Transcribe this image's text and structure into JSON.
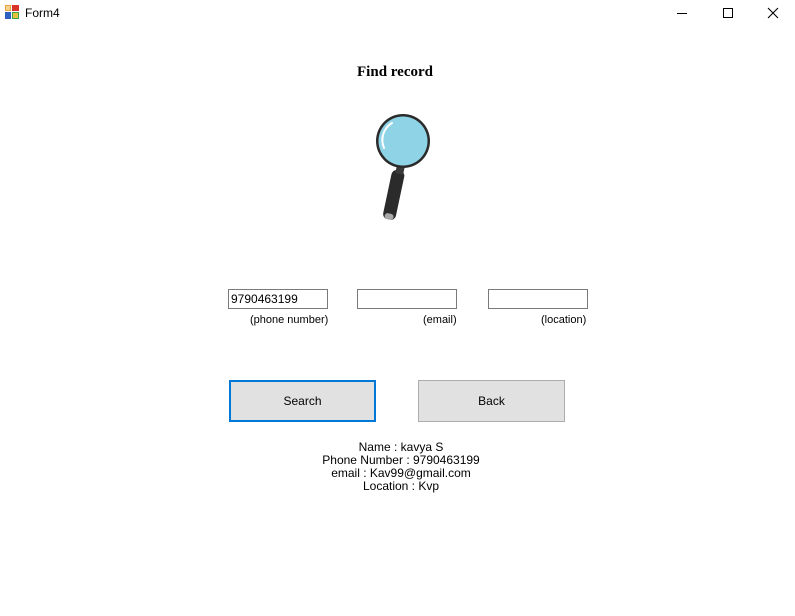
{
  "window": {
    "title": "Form4",
    "icon": "form-app-icon",
    "controls": [
      "minimize-icon",
      "maximize-icon",
      "close-icon"
    ]
  },
  "heading": "Find record",
  "illustration": "magnifying-glass-icon",
  "fields": {
    "phone": {
      "value": "9790463199",
      "label": "(phone number)"
    },
    "email": {
      "value": "",
      "label": "(email)"
    },
    "location": {
      "value": "",
      "label": "(location)"
    }
  },
  "buttons": {
    "search": "Search",
    "back": "Back"
  },
  "result": {
    "name": "Name : kavya S",
    "phone": "Phone Number : 9790463199",
    "email": "email : Kav99@gmail.com",
    "location": "Location : Kvp"
  },
  "colors": {
    "focus_border": "#0078d7",
    "button_face": "#e1e1e1",
    "lens": "#8fd3e6"
  }
}
